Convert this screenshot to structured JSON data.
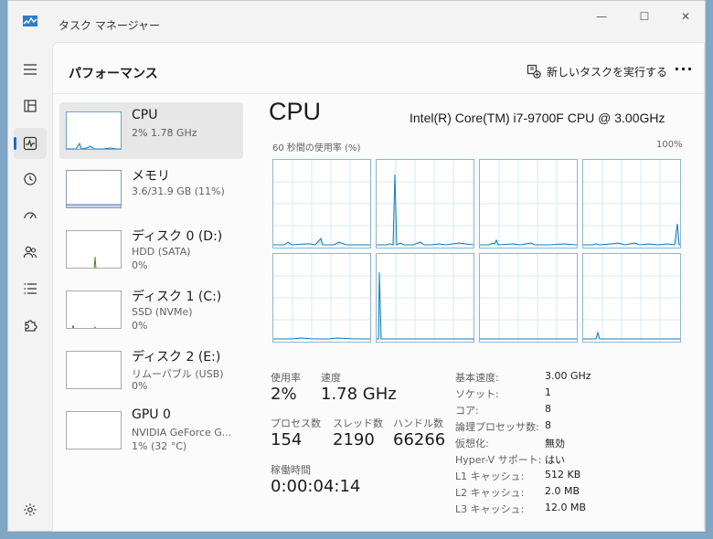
{
  "window": {
    "title": "タスク マネージャー"
  },
  "header": {
    "title": "パフォーマンス",
    "run_task_label": "新しいタスクを実行する",
    "more_label": "···"
  },
  "sidebar": {
    "items": [
      {
        "name": "CPU",
        "sub": "2%  1.78 GHz",
        "sub2": ""
      },
      {
        "name": "メモリ",
        "sub": "3.6/31.9 GB (11%)",
        "sub2": ""
      },
      {
        "name": "ディスク 0 (D:)",
        "sub": "HDD (SATA)",
        "sub2": "0%"
      },
      {
        "name": "ディスク 1 (C:)",
        "sub": "SSD (NVMe)",
        "sub2": "0%"
      },
      {
        "name": "ディスク 2 (E:)",
        "sub": "リムーバブル (USB)",
        "sub2": "0%"
      },
      {
        "name": "GPU 0",
        "sub": "NVIDIA GeForce G...",
        "sub2": "1%  (32 °C)"
      }
    ]
  },
  "cpu": {
    "heading": "CPU",
    "model": "Intel(R) Core(TM) i7-9700F CPU @ 3.00GHz",
    "graph_label": "60 秒間の使用率 (%)",
    "graph_max": "100%",
    "stats": {
      "usage_label": "使用率",
      "usage": "2%",
      "speed_label": "速度",
      "speed": "1.78 GHz",
      "processes_label": "プロセス数",
      "processes": "154",
      "threads_label": "スレッド数",
      "threads": "2190",
      "handles_label": "ハンドル数",
      "handles": "66266",
      "uptime_label": "稼働時間",
      "uptime": "0:00:04:14"
    },
    "specs": [
      {
        "label": "基本速度:",
        "value": "3.00 GHz"
      },
      {
        "label": "ソケット:",
        "value": "1"
      },
      {
        "label": "コア:",
        "value": "8"
      },
      {
        "label": "論理プロセッサ数:",
        "value": "8"
      },
      {
        "label": "仮想化:",
        "value": "無効"
      },
      {
        "label": "Hyper-V サポート:",
        "value": "はい"
      },
      {
        "label": "L1 キャッシュ:",
        "value": "512 KB"
      },
      {
        "label": "L2 キャッシュ:",
        "value": "2.0 MB"
      },
      {
        "label": "L3 キャッシュ:",
        "value": "12.0 MB"
      }
    ]
  },
  "colors": {
    "accent": "#1f6fbf",
    "graph_line": "#117dbb",
    "disk_line": "#4d8a2a"
  }
}
